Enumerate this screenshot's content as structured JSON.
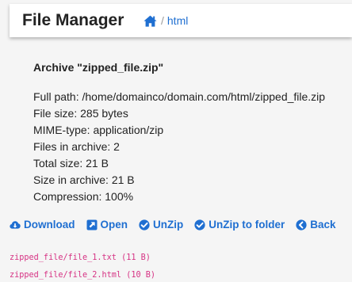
{
  "header": {
    "title": "File Manager",
    "breadcrumb": {
      "home_icon": "home-icon",
      "separator": "/",
      "current": "html"
    }
  },
  "archive": {
    "title": "Archive \"zipped_file.zip\"",
    "info": [
      "Full path: /home/domainco/domain.com/html/zipped_file.zip",
      "File size: 285 bytes",
      "MIME-type: application/zip",
      "Files in archive: 2",
      "Total size: 21 B",
      "Size in archive: 21 B",
      "Compression: 100%"
    ]
  },
  "actions": [
    {
      "label": "Download",
      "icon": "cloud-download-icon"
    },
    {
      "label": "Open",
      "icon": "external-link-icon"
    },
    {
      "label": "UnZip",
      "icon": "check-circle-icon"
    },
    {
      "label": "UnZip to folder",
      "icon": "check-circle-icon"
    },
    {
      "label": "Back",
      "icon": "chevron-left-circle-icon"
    }
  ],
  "files": [
    "zipped_file/file_1.txt (11 B)",
    "zipped_file/file_2.html (10 B)"
  ],
  "colors": {
    "link": "#1f6fd1",
    "code": "#d63384",
    "background": "#f5f5f5"
  }
}
